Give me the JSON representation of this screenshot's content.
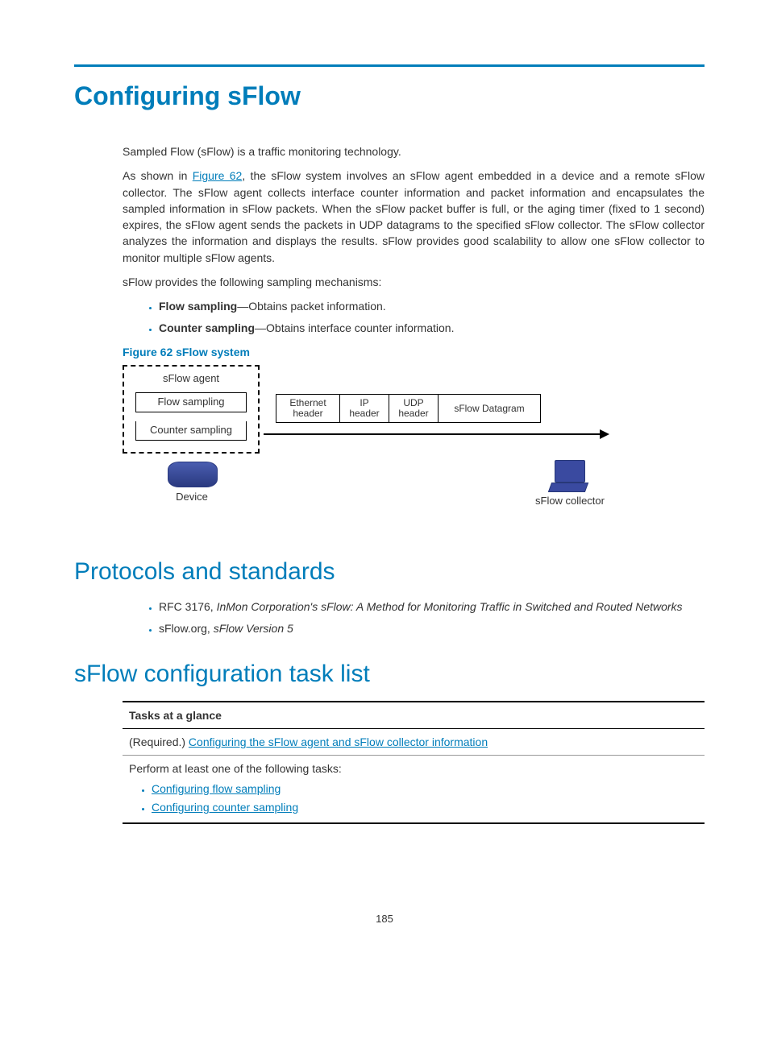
{
  "title": "Configuring sFlow",
  "intro": {
    "p1": "Sampled Flow (sFlow) is a traffic monitoring technology.",
    "p2_pre": "As shown in ",
    "p2_link": "Figure 62",
    "p2_post": ", the sFlow system involves an sFlow agent embedded in a device and a remote sFlow collector. The sFlow agent collects interface counter information and packet information and encapsulates the sampled information in sFlow packets. When the sFlow packet buffer is full, or the aging timer (fixed to 1 second) expires, the sFlow agent sends the packets in UDP datagrams to the specified sFlow collector. The sFlow collector analyzes the information and displays the results. sFlow provides good scalability to allow one sFlow collector to monitor multiple sFlow agents.",
    "p3": "sFlow provides the following sampling mechanisms:",
    "bullets": [
      {
        "bold": "Flow sampling",
        "rest": "—Obtains packet information."
      },
      {
        "bold": "Counter sampling",
        "rest": "—Obtains interface counter information."
      }
    ]
  },
  "figure": {
    "caption": "Figure 62 sFlow system",
    "agent_label": "sFlow agent",
    "flow_sampling": "Flow sampling",
    "counter_sampling": "Counter sampling",
    "packet": [
      "Ethernet header",
      "IP header",
      "UDP header",
      "sFlow Datagram"
    ],
    "device": "Device",
    "collector": "sFlow collector"
  },
  "protocols": {
    "heading": "Protocols and standards",
    "items": [
      {
        "pre": "RFC 3176, ",
        "ital": "InMon Corporation's sFlow: A Method for Monitoring Traffic in Switched and Routed Networks"
      },
      {
        "pre": "sFlow.org, ",
        "ital": "sFlow Version 5"
      }
    ]
  },
  "tasklist": {
    "heading": "sFlow configuration task list",
    "th": "Tasks at a glance",
    "row1_pre": "(Required.) ",
    "row1_link": "Configuring the sFlow agent and sFlow collector information",
    "row2_text": "Perform at least one of the following tasks:",
    "row2_links": [
      "Configuring flow sampling",
      "Configuring counter sampling"
    ]
  },
  "page_number": "185"
}
